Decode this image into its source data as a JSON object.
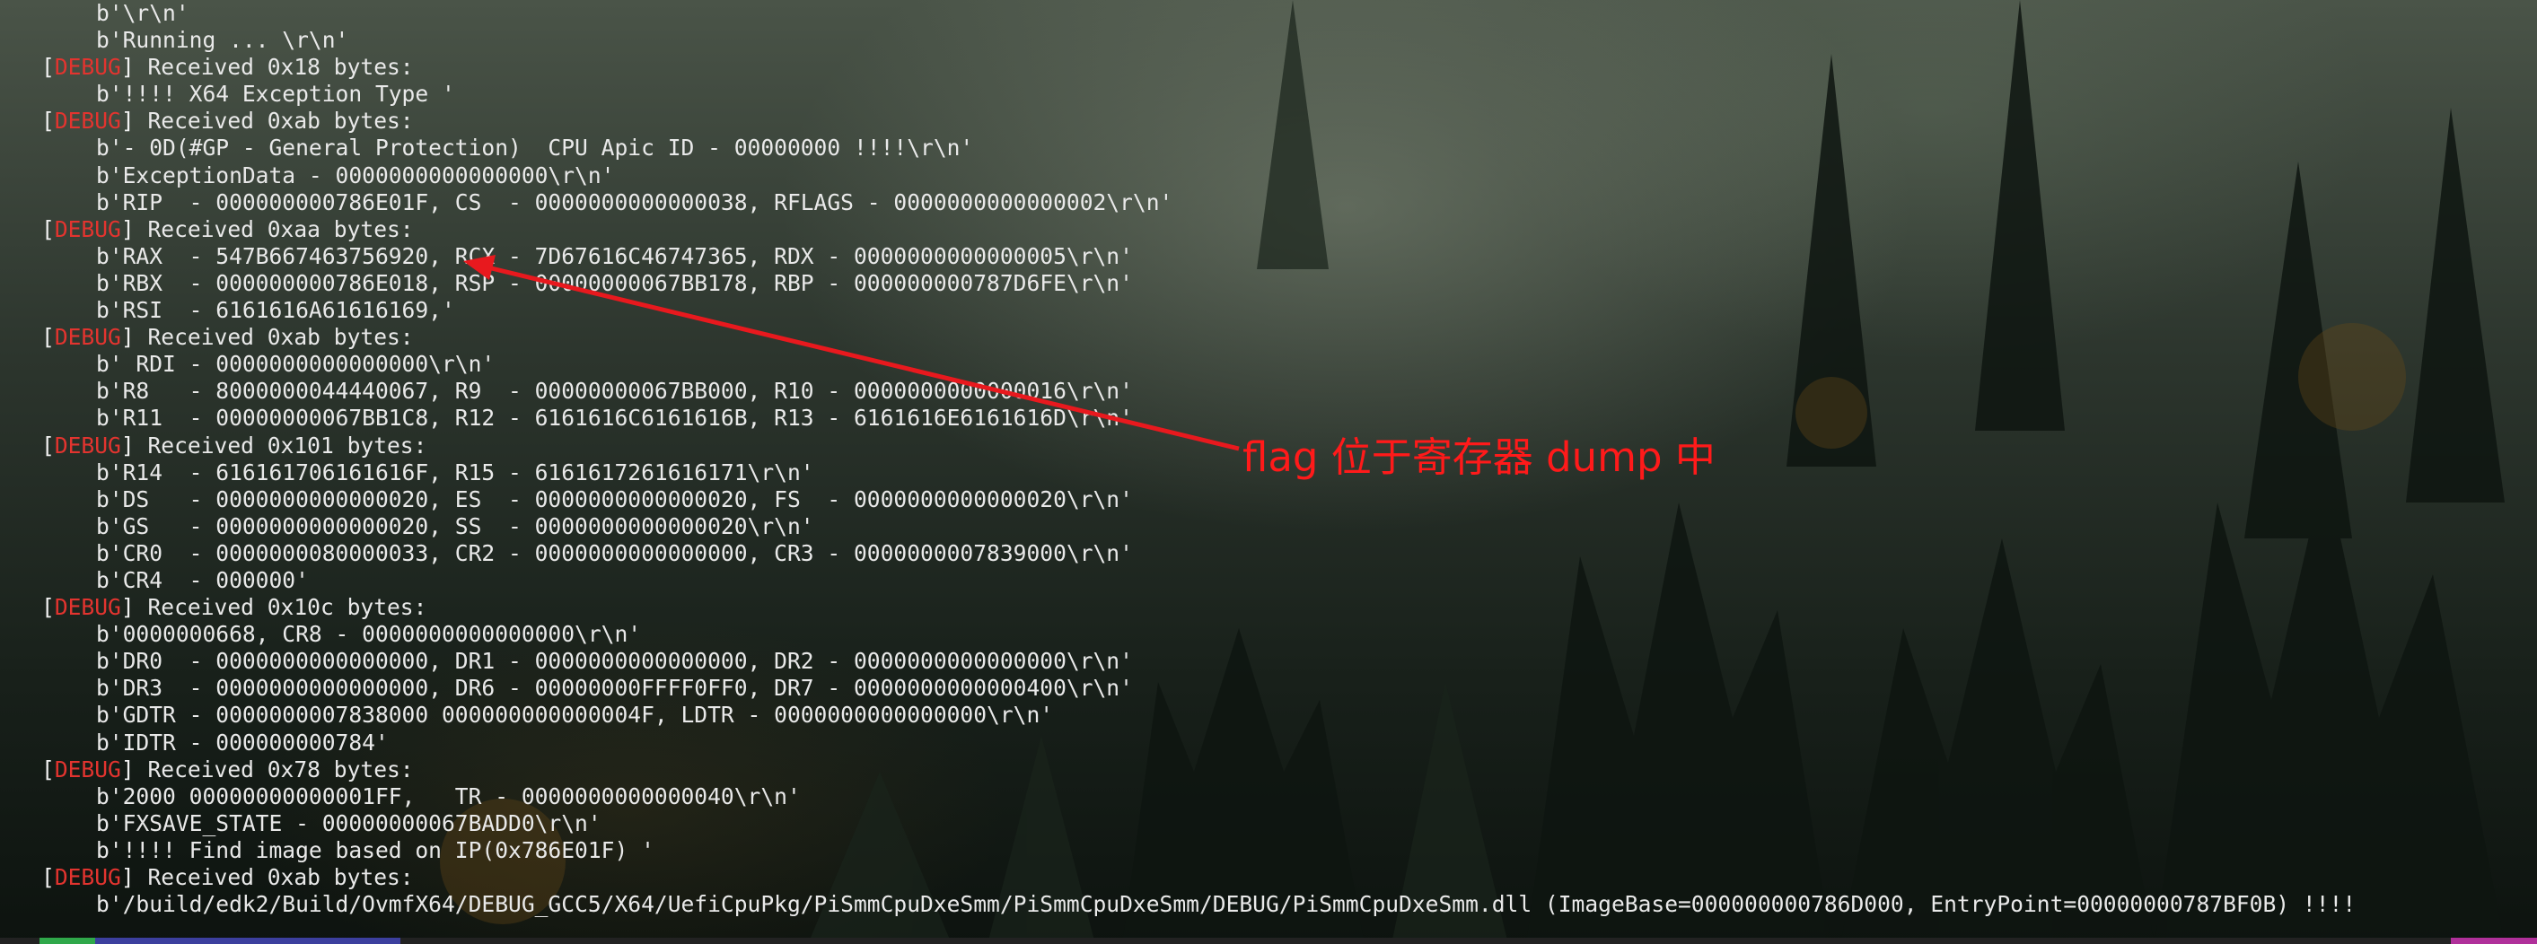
{
  "terminal": {
    "debug_tag": "DEBUG",
    "lines": [
      {
        "kind": "out",
        "text": "b'\\r\\n'"
      },
      {
        "kind": "out",
        "text": "b'Running ... \\r\\n'"
      },
      {
        "kind": "dbg",
        "text": " Received 0x18 bytes:"
      },
      {
        "kind": "out",
        "text": "b'!!!! X64 Exception Type '"
      },
      {
        "kind": "dbg",
        "text": " Received 0xab bytes:"
      },
      {
        "kind": "out",
        "text": "b'- 0D(#GP - General Protection)  CPU Apic ID - 00000000 !!!!\\r\\n'"
      },
      {
        "kind": "out",
        "text": "b'ExceptionData - 0000000000000000\\r\\n'"
      },
      {
        "kind": "out",
        "text": "b'RIP  - 000000000786E01F, CS  - 0000000000000038, RFLAGS - 0000000000000002\\r\\n'"
      },
      {
        "kind": "dbg",
        "text": " Received 0xaa bytes:"
      },
      {
        "kind": "out",
        "text": "b'RAX  - 547B667463756920, RCX - 7D67616C46747365, RDX - 0000000000000005\\r\\n'"
      },
      {
        "kind": "out",
        "text": "b'RBX  - 000000000786E018, RSP - 00000000067BB178, RBP - 000000000787D6FE\\r\\n'"
      },
      {
        "kind": "out",
        "text": "b'RSI  - 6161616A61616169,'"
      },
      {
        "kind": "dbg",
        "text": " Received 0xab bytes:"
      },
      {
        "kind": "out",
        "text": "b' RDI - 0000000000000000\\r\\n'"
      },
      {
        "kind": "out",
        "text": "b'R8   - 8000000044440067, R9  - 00000000067BB000, R10 - 0000000000000016\\r\\n'"
      },
      {
        "kind": "out",
        "text": "b'R11  - 00000000067BB1C8, R12 - 6161616C6161616B, R13 - 6161616E6161616D\\r\\n'"
      },
      {
        "kind": "dbg",
        "text": " Received 0x101 bytes:"
      },
      {
        "kind": "out",
        "text": "b'R14  - 616161706161616F, R15 - 6161617261616171\\r\\n'"
      },
      {
        "kind": "out",
        "text": "b'DS   - 0000000000000020, ES  - 0000000000000020, FS  - 0000000000000020\\r\\n'"
      },
      {
        "kind": "out",
        "text": "b'GS   - 0000000000000020, SS  - 0000000000000020\\r\\n'"
      },
      {
        "kind": "out",
        "text": "b'CR0  - 0000000080000033, CR2 - 0000000000000000, CR3 - 0000000007839000\\r\\n'"
      },
      {
        "kind": "out",
        "text": "b'CR4  - 000000'"
      },
      {
        "kind": "dbg",
        "text": " Received 0x10c bytes:"
      },
      {
        "kind": "out",
        "text": "b'0000000668, CR8 - 0000000000000000\\r\\n'"
      },
      {
        "kind": "out",
        "text": "b'DR0  - 0000000000000000, DR1 - 0000000000000000, DR2 - 0000000000000000\\r\\n'"
      },
      {
        "kind": "out",
        "text": "b'DR3  - 0000000000000000, DR6 - 00000000FFFF0FF0, DR7 - 0000000000000400\\r\\n'"
      },
      {
        "kind": "out",
        "text": "b'GDTR - 0000000007838000 000000000000004F, LDTR - 0000000000000000\\r\\n'"
      },
      {
        "kind": "out",
        "text": "b'IDTR - 000000000784'"
      },
      {
        "kind": "dbg",
        "text": " Received 0x78 bytes:"
      },
      {
        "kind": "out",
        "text": "b'2000 00000000000001FF,   TR - 0000000000000040\\r\\n'"
      },
      {
        "kind": "out",
        "text": "b'FXSAVE_STATE - 00000000067BADD0\\r\\n'"
      },
      {
        "kind": "out",
        "text": "b'!!!! Find image based on IP(0x786E01F) '"
      },
      {
        "kind": "dbg",
        "text": " Received 0xab bytes:"
      },
      {
        "kind": "out",
        "text": "b'/build/edk2/Build/OvmfX64/DEBUG_GCC5/X64/UefiCpuPkg/PiSmmCpuDxeSmm/PiSmmCpuDxeSmm/DEBUG/PiSmmCpuDxeSmm.dll (ImageBase=000000000786D000, EntryPoint=00000000787BF0B) !!!!"
      }
    ]
  },
  "annotation": {
    "text": "flag 位于寄存器 dump 中",
    "color": "#ff1a1a"
  },
  "colors": {
    "debug_tag": "#e3342f",
    "terminal_text": "#e9e9e9"
  }
}
